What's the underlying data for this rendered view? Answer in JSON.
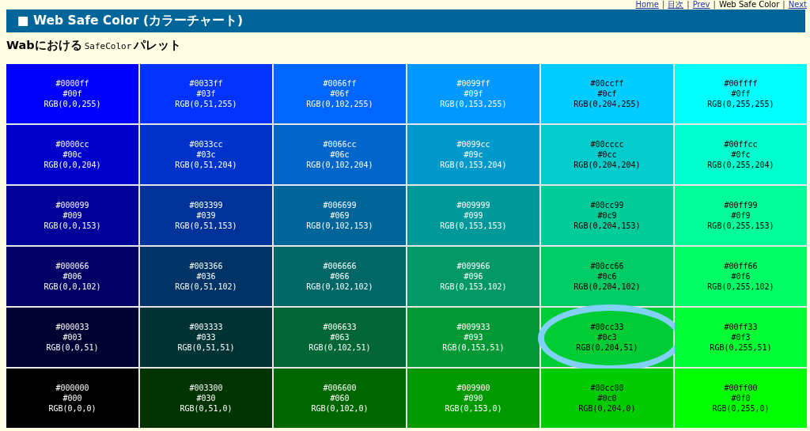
{
  "nav_separator": "|",
  "nav": [
    {
      "label": "Home",
      "link": true
    },
    {
      "label": "目次",
      "link": true
    },
    {
      "label": "Prev",
      "link": true
    },
    {
      "label": "Web Safe Color",
      "link": false
    },
    {
      "label": "Next",
      "link": true
    }
  ],
  "title": "■ Web Safe Color (カラーチャート)",
  "subtitle": [
    {
      "text": "Wabにおける",
      "kind": "bold"
    },
    {
      "text": "SafeColor",
      "kind": "mono"
    },
    {
      "text": "パレット",
      "kind": "bold"
    }
  ],
  "rows": [
    [
      {
        "color": "#0000ff",
        "hex": "#0000ff",
        "short": "#00f",
        "rgb": "RGB(0,0,255)",
        "highlighted": false
      },
      {
        "color": "#0033ff",
        "hex": "#0033ff",
        "short": "#03f",
        "rgb": "RGB(0,51,255)",
        "highlighted": false
      },
      {
        "color": "#0066ff",
        "hex": "#0066ff",
        "short": "#06f",
        "rgb": "RGB(0,102,255)",
        "highlighted": false
      },
      {
        "color": "#0099ff",
        "hex": "#0099ff",
        "short": "#09f",
        "rgb": "RGB(0,153,255)",
        "highlighted": false
      },
      {
        "color": "#00ccff",
        "hex": "#00ccff",
        "short": "#0cf",
        "rgb": "RGB(0,204,255)",
        "highlighted": false
      },
      {
        "color": "#00ffff",
        "hex": "#00ffff",
        "short": "#0ff",
        "rgb": "RGB(0,255,255)",
        "highlighted": false
      }
    ],
    [
      {
        "color": "#0000cc",
        "hex": "#0000cc",
        "short": "#00c",
        "rgb": "RGB(0,0,204)",
        "highlighted": false
      },
      {
        "color": "#0033cc",
        "hex": "#0033cc",
        "short": "#03c",
        "rgb": "RGB(0,51,204)",
        "highlighted": false
      },
      {
        "color": "#0066cc",
        "hex": "#0066cc",
        "short": "#06c",
        "rgb": "RGB(0,102,204)",
        "highlighted": false
      },
      {
        "color": "#0099cc",
        "hex": "#0099cc",
        "short": "#09c",
        "rgb": "RGB(0,153,204)",
        "highlighted": false
      },
      {
        "color": "#00cccc",
        "hex": "#00cccc",
        "short": "#0cc",
        "rgb": "RGB(0,204,204)",
        "highlighted": false
      },
      {
        "color": "#00ffcc",
        "hex": "#00ffcc",
        "short": "#0fc",
        "rgb": "RGB(0,255,204)",
        "highlighted": false
      }
    ],
    [
      {
        "color": "#000099",
        "hex": "#000099",
        "short": "#009",
        "rgb": "RGB(0,0,153)",
        "highlighted": false
      },
      {
        "color": "#003399",
        "hex": "#003399",
        "short": "#039",
        "rgb": "RGB(0,51,153)",
        "highlighted": false
      },
      {
        "color": "#006699",
        "hex": "#006699",
        "short": "#069",
        "rgb": "RGB(0,102,153)",
        "highlighted": false
      },
      {
        "color": "#009999",
        "hex": "#009999",
        "short": "#099",
        "rgb": "RGB(0,153,153)",
        "highlighted": false
      },
      {
        "color": "#00cc99",
        "hex": "#00cc99",
        "short": "#0c9",
        "rgb": "RGB(0,204,153)",
        "highlighted": false
      },
      {
        "color": "#00ff99",
        "hex": "#00ff99",
        "short": "#0f9",
        "rgb": "RGB(0,255,153)",
        "highlighted": false
      }
    ],
    [
      {
        "color": "#000066",
        "hex": "#000066",
        "short": "#006",
        "rgb": "RGB(0,0,102)",
        "highlighted": false
      },
      {
        "color": "#003366",
        "hex": "#003366",
        "short": "#036",
        "rgb": "RGB(0,51,102)",
        "highlighted": false
      },
      {
        "color": "#006666",
        "hex": "#006666",
        "short": "#066",
        "rgb": "RGB(0,102,102)",
        "highlighted": false
      },
      {
        "color": "#009966",
        "hex": "#009966",
        "short": "#096",
        "rgb": "RGB(0,153,102)",
        "highlighted": false
      },
      {
        "color": "#00cc66",
        "hex": "#00cc66",
        "short": "#0c6",
        "rgb": "RGB(0,204,102)",
        "highlighted": false
      },
      {
        "color": "#00ff66",
        "hex": "#00ff66",
        "short": "#0f6",
        "rgb": "RGB(0,255,102)",
        "highlighted": false
      }
    ],
    [
      {
        "color": "#000033",
        "hex": "#000033",
        "short": "#003",
        "rgb": "RGB(0,0,51)",
        "highlighted": false
      },
      {
        "color": "#003333",
        "hex": "#003333",
        "short": "#033",
        "rgb": "RGB(0,51,51)",
        "highlighted": false
      },
      {
        "color": "#006633",
        "hex": "#006633",
        "short": "#063",
        "rgb": "RGB(0,102,51)",
        "highlighted": false
      },
      {
        "color": "#009933",
        "hex": "#009933",
        "short": "#093",
        "rgb": "RGB(0,153,51)",
        "highlighted": false
      },
      {
        "color": "#00cc33",
        "hex": "#00cc33",
        "short": "#0c3",
        "rgb": "RGB(0,204,51)",
        "highlighted": true
      },
      {
        "color": "#00ff33",
        "hex": "#00ff33",
        "short": "#0f3",
        "rgb": "RGB(0,255,51)",
        "highlighted": false
      }
    ],
    [
      {
        "color": "#000000",
        "hex": "#000000",
        "short": "#000",
        "rgb": "RGB(0,0,0)",
        "highlighted": false
      },
      {
        "color": "#003300",
        "hex": "#003300",
        "short": "#030",
        "rgb": "RGB(0,51,0)",
        "highlighted": false
      },
      {
        "color": "#006600",
        "hex": "#006600",
        "short": "#060",
        "rgb": "RGB(0,102,0)",
        "highlighted": false
      },
      {
        "color": "#009900",
        "hex": "#009900",
        "short": "#090",
        "rgb": "RGB(0,153,0)",
        "highlighted": false
      },
      {
        "color": "#00cc00",
        "hex": "#00cc00",
        "short": "#0c0",
        "rgb": "RGB(0,204,0)",
        "highlighted": false
      },
      {
        "color": "#00ff00",
        "hex": "#00ff00",
        "short": "#0f0",
        "rgb": "RGB(0,255,0)",
        "highlighted": false
      }
    ]
  ]
}
